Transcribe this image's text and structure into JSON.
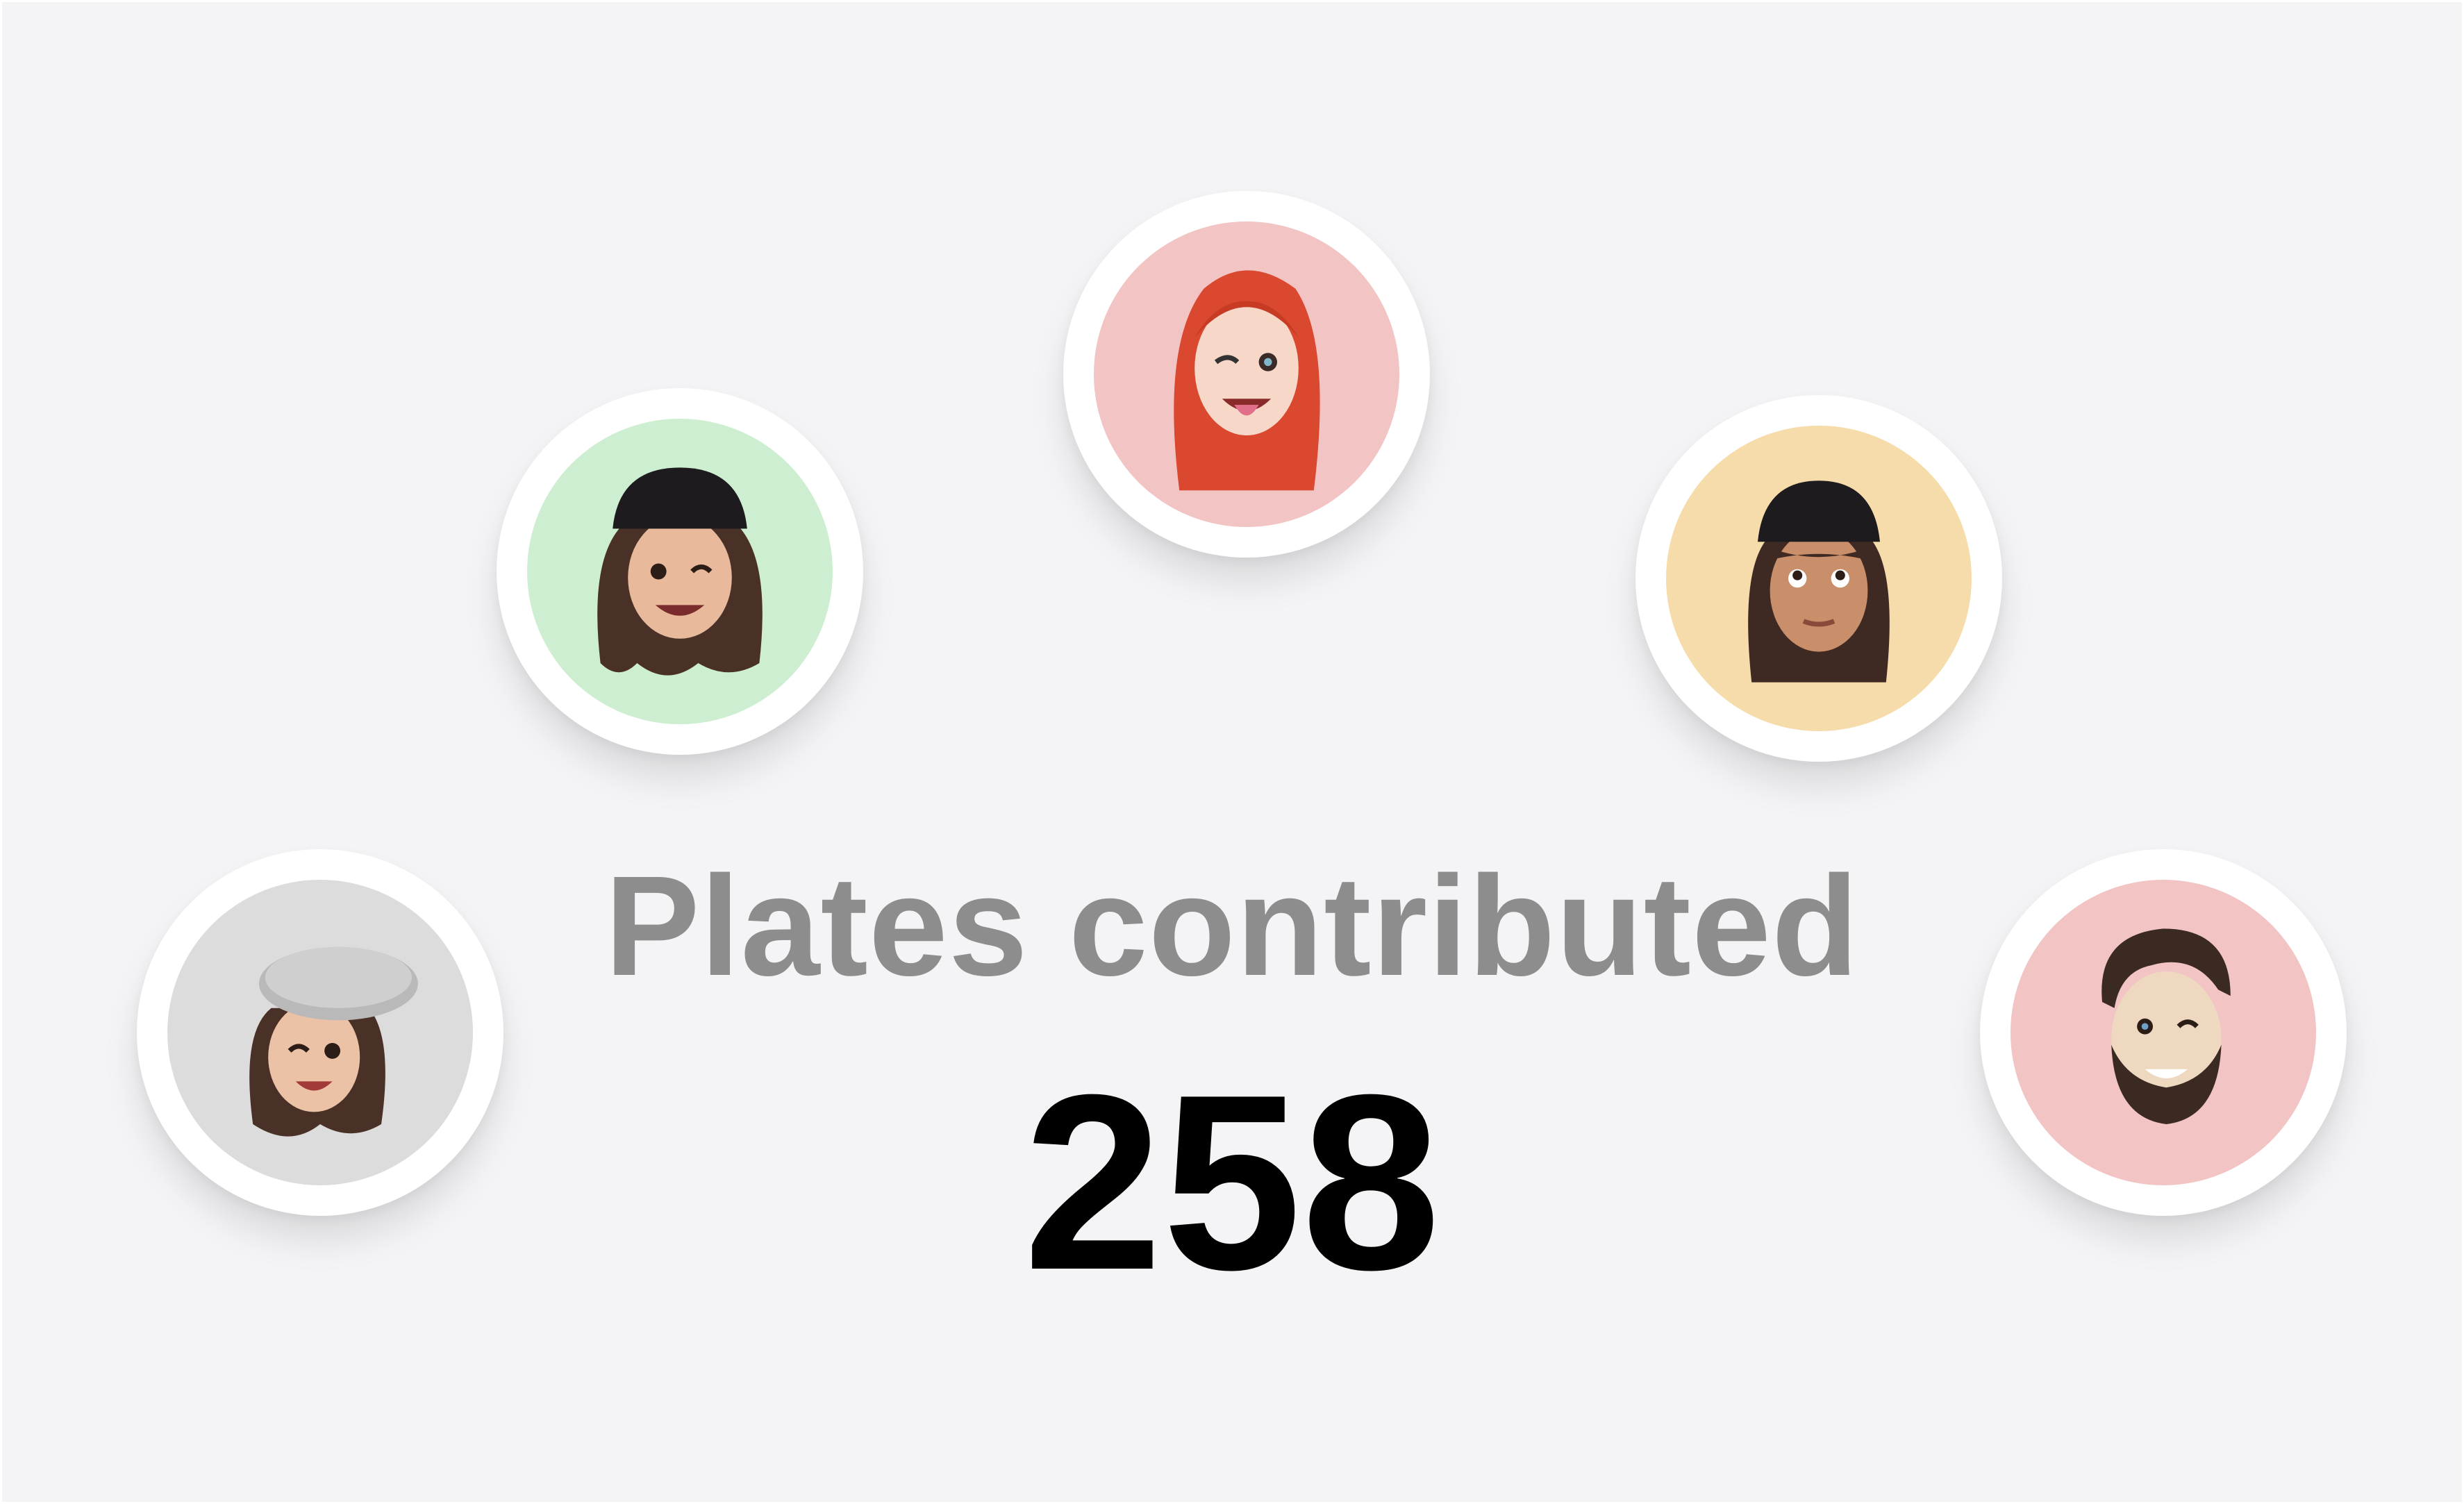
{
  "stat": {
    "label": "Plates contributed",
    "value": "258"
  },
  "avatars": [
    {
      "id": "red-hair-memoji",
      "bg": "#f2c4c4"
    },
    {
      "id": "green-beanie-memoji",
      "bg": "#cdeed0"
    },
    {
      "id": "yellow-beanie-memoji",
      "bg": "#f6dcaa"
    },
    {
      "id": "beret-memoji",
      "bg": "#dcdcdc"
    },
    {
      "id": "bearded-man-memoji",
      "bg": "#f2c4c4"
    }
  ]
}
